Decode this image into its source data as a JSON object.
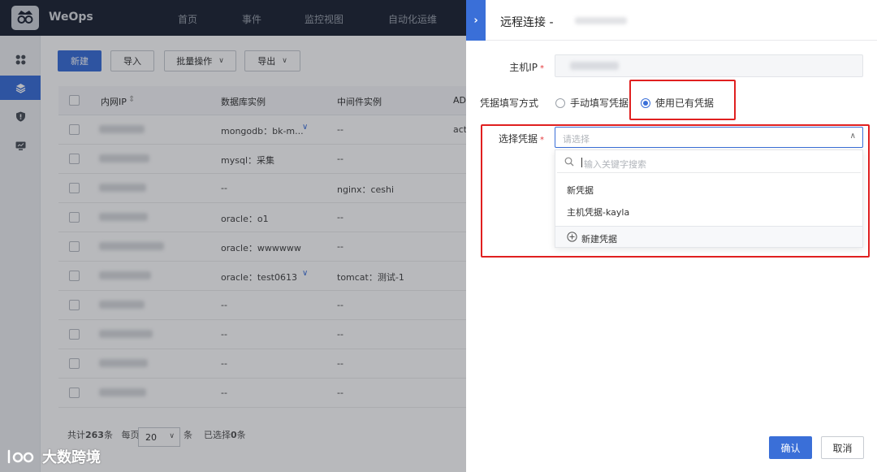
{
  "app": {
    "brand": "WeOps"
  },
  "topnav": [
    {
      "label": "首页"
    },
    {
      "label": "事件"
    },
    {
      "label": "监控视图"
    },
    {
      "label": "自动化运维"
    }
  ],
  "sidebar": {
    "items": [
      {
        "icon": "grid-icon"
      },
      {
        "icon": "layers-icon",
        "active": true
      },
      {
        "icon": "shield-icon"
      },
      {
        "icon": "monitor-icon"
      }
    ]
  },
  "toolbar": {
    "new_label": "新建",
    "import_label": "导入",
    "batch_label": "批量操作",
    "export_label": "导出"
  },
  "table": {
    "columns": [
      "内网IP",
      "数据库实例",
      "中间件实例",
      "AD"
    ],
    "rows": [
      {
        "db": "mongodb：bk-m...",
        "mw": "--",
        "ad": "act",
        "expand": true
      },
      {
        "db": "mysql：采集",
        "mw": "--",
        "ad": ""
      },
      {
        "db": "--",
        "mw": "nginx：ceshi",
        "ad": ""
      },
      {
        "db": "oracle：o1",
        "mw": "--",
        "ad": ""
      },
      {
        "db": "oracle：wwwwww",
        "mw": "--",
        "ad": ""
      },
      {
        "db": "oracle：test0613",
        "mw": "tomcat：测试-1",
        "ad": "",
        "expand": true
      },
      {
        "db": "--",
        "mw": "--",
        "ad": ""
      },
      {
        "db": "--",
        "mw": "--",
        "ad": ""
      },
      {
        "db": "--",
        "mw": "--",
        "ad": ""
      },
      {
        "db": "--",
        "mw": "--",
        "ad": ""
      }
    ]
  },
  "pagination": {
    "total_prefix": "共计",
    "total": "263",
    "total_suffix": "条",
    "per_page_prefix": "每页",
    "page_size": "20",
    "per_page_suffix": "条",
    "selected_prefix": "已选择",
    "selected": "0",
    "selected_suffix": "条"
  },
  "drawer": {
    "title": "远程连接 -",
    "expand_icon": "chevron-right-icon",
    "host_ip_label": "主机IP",
    "credential_mode_label": "凭据填写方式",
    "radio_manual": "手动填写凭据",
    "radio_existing": "使用已有凭据",
    "select_credential_label": "选择凭据",
    "select_placeholder": "请选择",
    "search_placeholder": "输入关键字搜索",
    "options": [
      "新凭据",
      "主机凭据-kayla"
    ],
    "new_credential_label": "新建凭据",
    "confirm_label": "确认",
    "cancel_label": "取消"
  },
  "watermark": {
    "text": "大数跨境"
  },
  "colors": {
    "accent": "#3a6fd8",
    "highlight": "#e02020",
    "header": "#1e2534"
  }
}
